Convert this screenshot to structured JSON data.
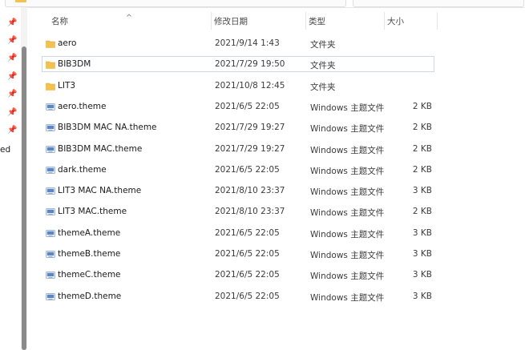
{
  "nav": {
    "pinned_count": 7,
    "fragment_text": "ed"
  },
  "columns": {
    "name": "名称",
    "date": "修改日期",
    "type": "类型",
    "size": "大小"
  },
  "files": [
    {
      "name": "aero",
      "date": "2021/9/14 1:43",
      "type": "文件夹",
      "size": "",
      "kind": "folder",
      "selected": false
    },
    {
      "name": "BIB3DM",
      "date": "2021/7/29 19:50",
      "type": "文件夹",
      "size": "",
      "kind": "folder",
      "selected": true
    },
    {
      "name": "LIT3",
      "date": "2021/10/8 12:45",
      "type": "文件夹",
      "size": "",
      "kind": "folder",
      "selected": false
    },
    {
      "name": "aero.theme",
      "date": "2021/6/5 22:05",
      "type": "Windows 主题文件",
      "size": "2 KB",
      "kind": "theme",
      "selected": false
    },
    {
      "name": "BIB3DM MAC NA.theme",
      "date": "2021/7/29 19:27",
      "type": "Windows 主题文件",
      "size": "2 KB",
      "kind": "theme",
      "selected": false
    },
    {
      "name": "BIB3DM MAC.theme",
      "date": "2021/7/29 19:27",
      "type": "Windows 主题文件",
      "size": "2 KB",
      "kind": "theme",
      "selected": false
    },
    {
      "name": "dark.theme",
      "date": "2021/6/5 22:05",
      "type": "Windows 主题文件",
      "size": "2 KB",
      "kind": "theme",
      "selected": false
    },
    {
      "name": "LIT3 MAC NA.theme",
      "date": "2021/8/10 23:37",
      "type": "Windows 主题文件",
      "size": "3 KB",
      "kind": "theme",
      "selected": false
    },
    {
      "name": "LIT3 MAC.theme",
      "date": "2021/8/10 23:37",
      "type": "Windows 主题文件",
      "size": "2 KB",
      "kind": "theme",
      "selected": false
    },
    {
      "name": "themeA.theme",
      "date": "2021/6/5 22:05",
      "type": "Windows 主题文件",
      "size": "3 KB",
      "kind": "theme",
      "selected": false
    },
    {
      "name": "themeB.theme",
      "date": "2021/6/5 22:05",
      "type": "Windows 主题文件",
      "size": "3 KB",
      "kind": "theme",
      "selected": false
    },
    {
      "name": "themeC.theme",
      "date": "2021/6/5 22:05",
      "type": "Windows 主题文件",
      "size": "3 KB",
      "kind": "theme",
      "selected": false
    },
    {
      "name": "themeD.theme",
      "date": "2021/6/5 22:05",
      "type": "Windows 主题文件",
      "size": "3 KB",
      "kind": "theme",
      "selected": false
    }
  ],
  "colors": {
    "folder": "#f2c14e",
    "folder_dark": "#d9a531",
    "selection_border": "#cfd9e6",
    "theme_icon": "#5b86c4"
  },
  "icons": {
    "folder": "folder-icon",
    "theme": "theme-file-icon",
    "pin": "pin-icon"
  }
}
